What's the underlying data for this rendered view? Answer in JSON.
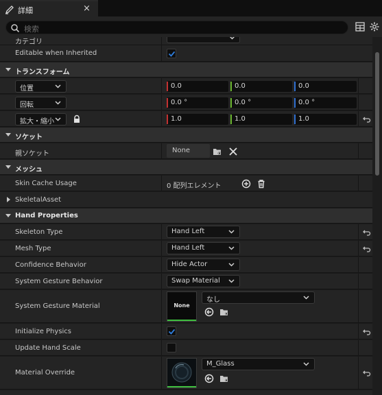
{
  "tab": {
    "title": "詳細",
    "close": "×"
  },
  "search": {
    "placeholder": "検索"
  },
  "rows_top": {
    "partial_label": "カテゴリ",
    "editable_label": "Editable when Inherited"
  },
  "transform": {
    "title": "トランスフォーム",
    "location": {
      "label": "位置",
      "x": "0.0",
      "y": "0.0",
      "z": "0.0"
    },
    "rotation": {
      "label": "回転",
      "x": "0.0 °",
      "y": "0.0 °",
      "z": "0.0 °"
    },
    "scale": {
      "label": "拡大・縮小",
      "x": "1.0",
      "y": "1.0",
      "z": "1.0"
    }
  },
  "socket": {
    "title": "ソケット",
    "parent_label": "親ソケット",
    "parent_value": "None"
  },
  "mesh": {
    "title": "メッシュ",
    "skin_cache_label": "Skin Cache Usage",
    "skin_cache_value": "0 配列エレメント",
    "skeletal_asset_label": "SkeletalAsset"
  },
  "hand": {
    "title": "Hand Properties",
    "skeleton_type": {
      "label": "Skeleton Type",
      "value": "Hand Left"
    },
    "mesh_type": {
      "label": "Mesh Type",
      "value": "Hand Left"
    },
    "confidence": {
      "label": "Confidence Behavior",
      "value": "Hide Actor"
    },
    "gesture_behavior": {
      "label": "System Gesture Behavior",
      "value": "Swap Material"
    },
    "gesture_material": {
      "label": "System Gesture Material",
      "thumb": "None",
      "value": "なし"
    },
    "init_physics": {
      "label": "Initialize Physics",
      "checked": true
    },
    "update_scale": {
      "label": "Update Hand Scale",
      "checked": false
    },
    "material_override": {
      "label": "Material Override",
      "value": "M_Glass"
    }
  },
  "colors": {
    "x_axis": "#c43131",
    "y_axis": "#6ab52e",
    "z_axis": "#2f6fd1",
    "check": "#2f7fe0",
    "accent_green": "#3fbf3f"
  }
}
